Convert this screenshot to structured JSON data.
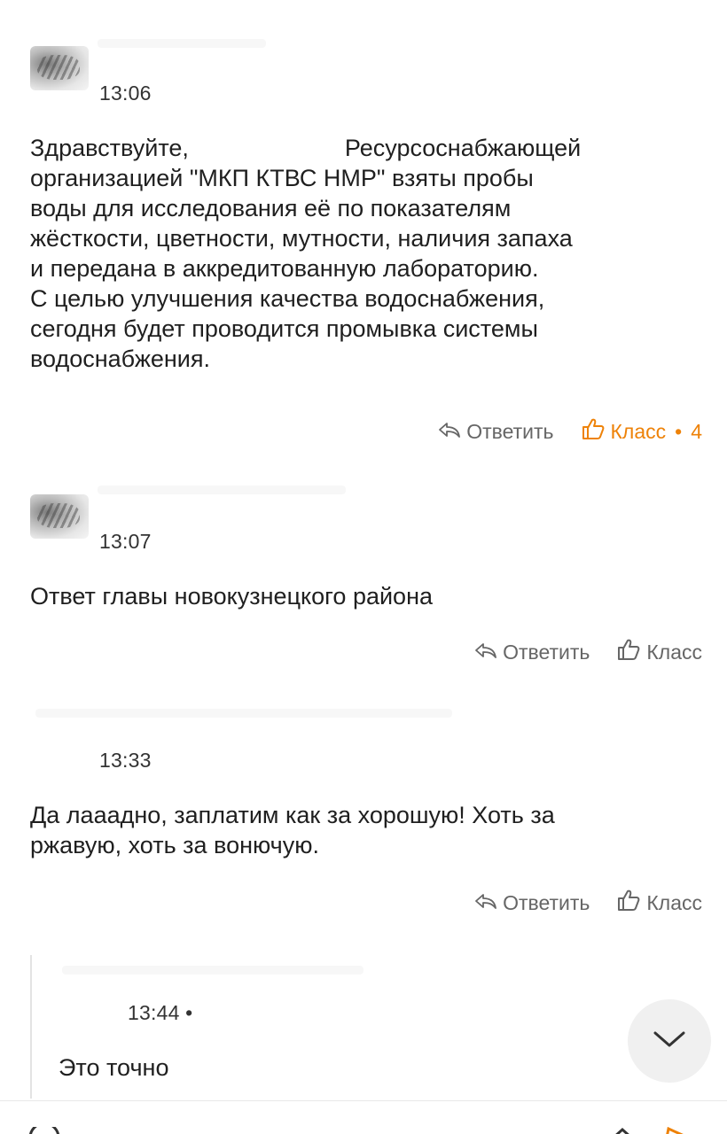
{
  "comments": [
    {
      "time": "13:06",
      "text_line1_a": "Здравствуйте,",
      "text_line1_b": "Ресурсоснабжающей",
      "text_rest": "организацией \"МКП КТВС НМР\" взяты пробы\nводы для исследования её по показателям\nжёсткости, цветности, мутности, наличия запаха\nи передана в аккредитованную лабораторию.\nС целью улучшения качества водоснабжения,\nсегодня будет проводится промывка системы\nводоснабжения.",
      "reply_label": "Ответить",
      "class_label": "Класс",
      "class_dot": "•",
      "class_count": "4"
    },
    {
      "time": "13:07",
      "text": "Ответ главы новокузнецкого района",
      "reply_label": "Ответить",
      "class_label": "Класс"
    },
    {
      "time": "13:33",
      "text": "Да лааадно, заплатим как за хорошую! Хоть за\nржавую, хоть за вонючую.",
      "reply_label": "Ответить",
      "class_label": "Класс"
    },
    {
      "time": "13:44 •",
      "text": "Это точно"
    }
  ],
  "colors": {
    "accent": "#ee8208",
    "action_gray": "#666666"
  },
  "icons": [
    "reply-icon",
    "like-icon",
    "chevron-down-icon"
  ]
}
